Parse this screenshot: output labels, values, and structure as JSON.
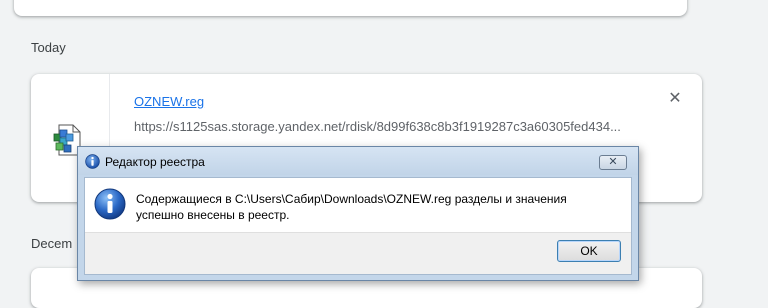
{
  "downloads": {
    "groups": [
      {
        "date_label": "Today",
        "item": {
          "file_name": "OZNEW.reg",
          "url": "https://s1125sas.storage.yandex.net/rdisk/8d99f638c8b3f1919287c3a60305fed434...",
          "remove_symbol": "✕",
          "icon": "registry-file-icon"
        }
      },
      {
        "date_label": "Decem"
      }
    ]
  },
  "dialog": {
    "title": "Редактор реестра",
    "title_icon": "info-icon",
    "close_symbol": "✕",
    "message": "Содержащиеся в C:\\Users\\Сабир\\Downloads\\OZNEW.reg разделы и значения успешно внесены в реестр.",
    "message_icon": "info-icon",
    "ok_label": "OK"
  }
}
